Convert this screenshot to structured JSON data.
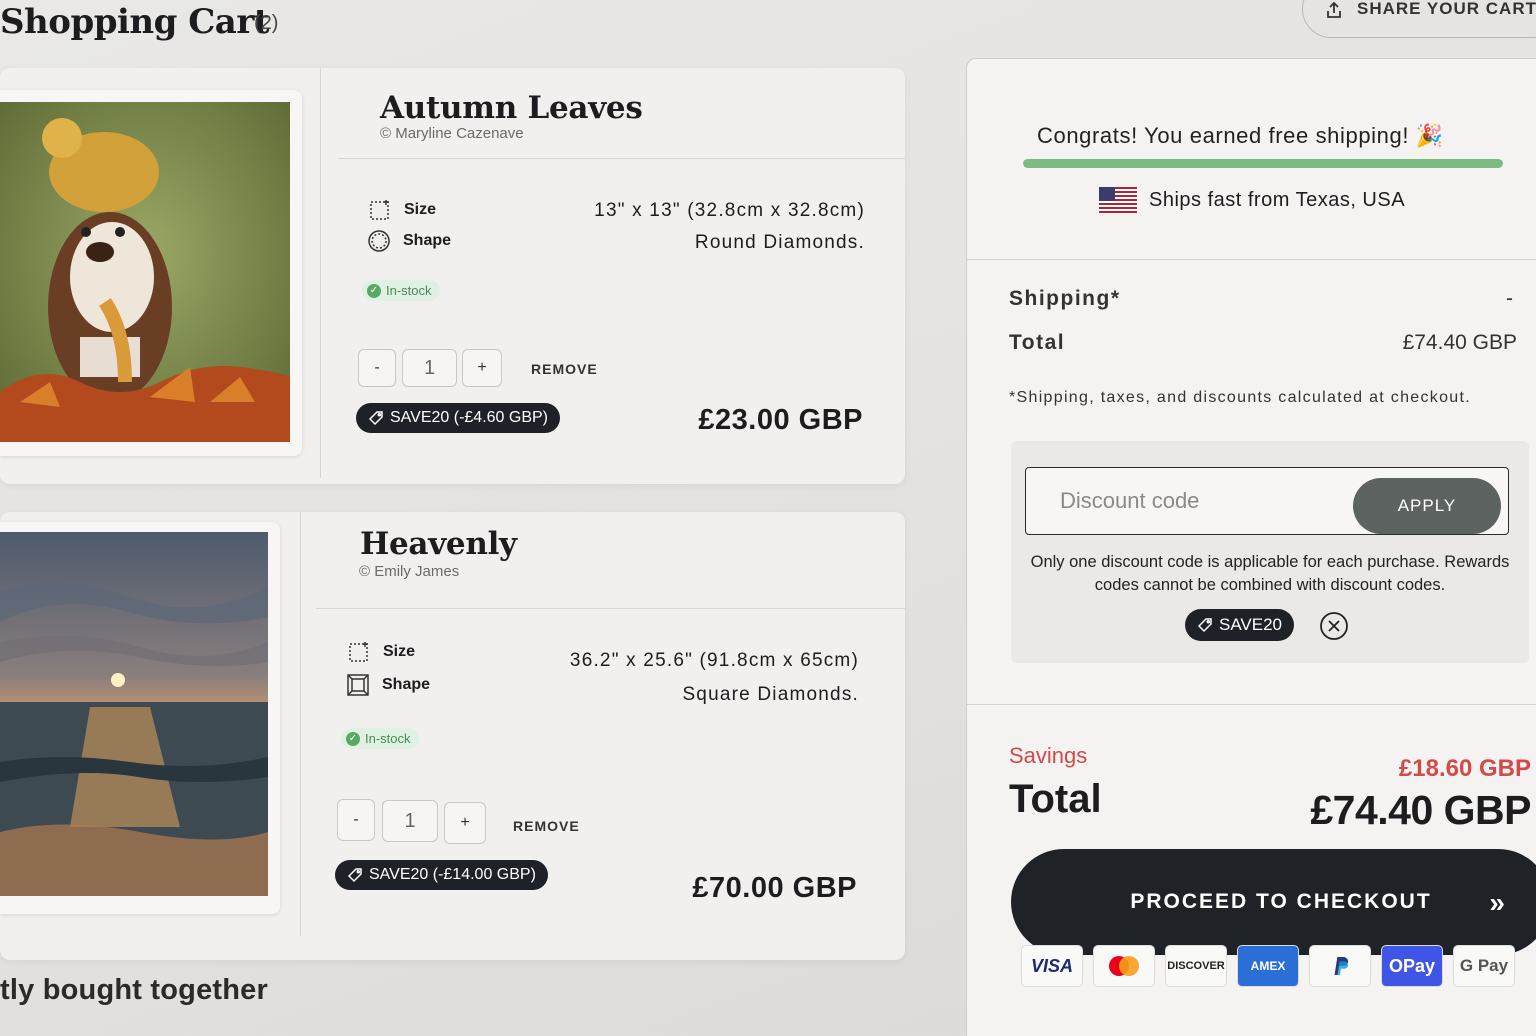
{
  "header": {
    "title": "Shopping Cart",
    "count": "(2)",
    "share_label": "SHARE YOUR CART"
  },
  "items": [
    {
      "title": "Autumn Leaves",
      "artist": "© Maryline Cazenave",
      "size_label": "Size",
      "size_value": "13\" x 13\" (32.8cm x 32.8cm)",
      "shape_label": "Shape",
      "shape_value": "Round Diamonds.",
      "stock": "In-stock",
      "qty_minus": "-",
      "quantity": "1",
      "qty_plus": "+",
      "remove_label": "REMOVE",
      "promo": "SAVE20 (-£4.60 GBP)",
      "price": "£23.00 GBP"
    },
    {
      "title": "Heavenly",
      "artist": "© Emily James",
      "size_label": "Size",
      "size_value": "36.2\" x 25.6\" (91.8cm x 65cm)",
      "shape_label": "Shape",
      "shape_value": "Square Diamonds.",
      "stock": "In-stock",
      "qty_minus": "-",
      "quantity": "1",
      "qty_plus": "+",
      "remove_label": "REMOVE",
      "promo": "SAVE20 (-£14.00 GBP)",
      "price": "£70.00 GBP"
    }
  ],
  "section_heading": "tly bought together",
  "summary": {
    "congrats": "Congrats! You earned free shipping! 🎉",
    "shipping_progress": 1.0,
    "ships_from": "Ships fast from Texas, USA",
    "shipping_label": "Shipping*",
    "shipping_value": "-",
    "total_label": "Total",
    "total_value": "£74.40 GBP",
    "fine_print": "*Shipping, taxes, and discounts calculated at checkout.",
    "discount_placeholder": "Discount code",
    "apply_label": "APPLY",
    "discount_note": "Only one discount code is applicable for each purchase. Rewards codes cannot be combined with discount codes.",
    "applied_code": "SAVE20",
    "savings_label": "Savings",
    "savings_value": "£18.60 GBP",
    "grand_total_label": "Total",
    "grand_total_value": "£74.40 GBP",
    "checkout_label": "PROCEED TO CHECKOUT",
    "checkout_chevron": "»"
  },
  "payment_methods": {
    "visa": "VISA",
    "discover": "DISCOVER",
    "amex": "AMEX",
    "opay": "OPay",
    "gpay": "G Pay"
  },
  "colors": {
    "accent_dark": "#1f2227",
    "savings_red": "#d24a4a",
    "in_stock_green": "#5aa866",
    "progress_green": "#7dbb80"
  }
}
